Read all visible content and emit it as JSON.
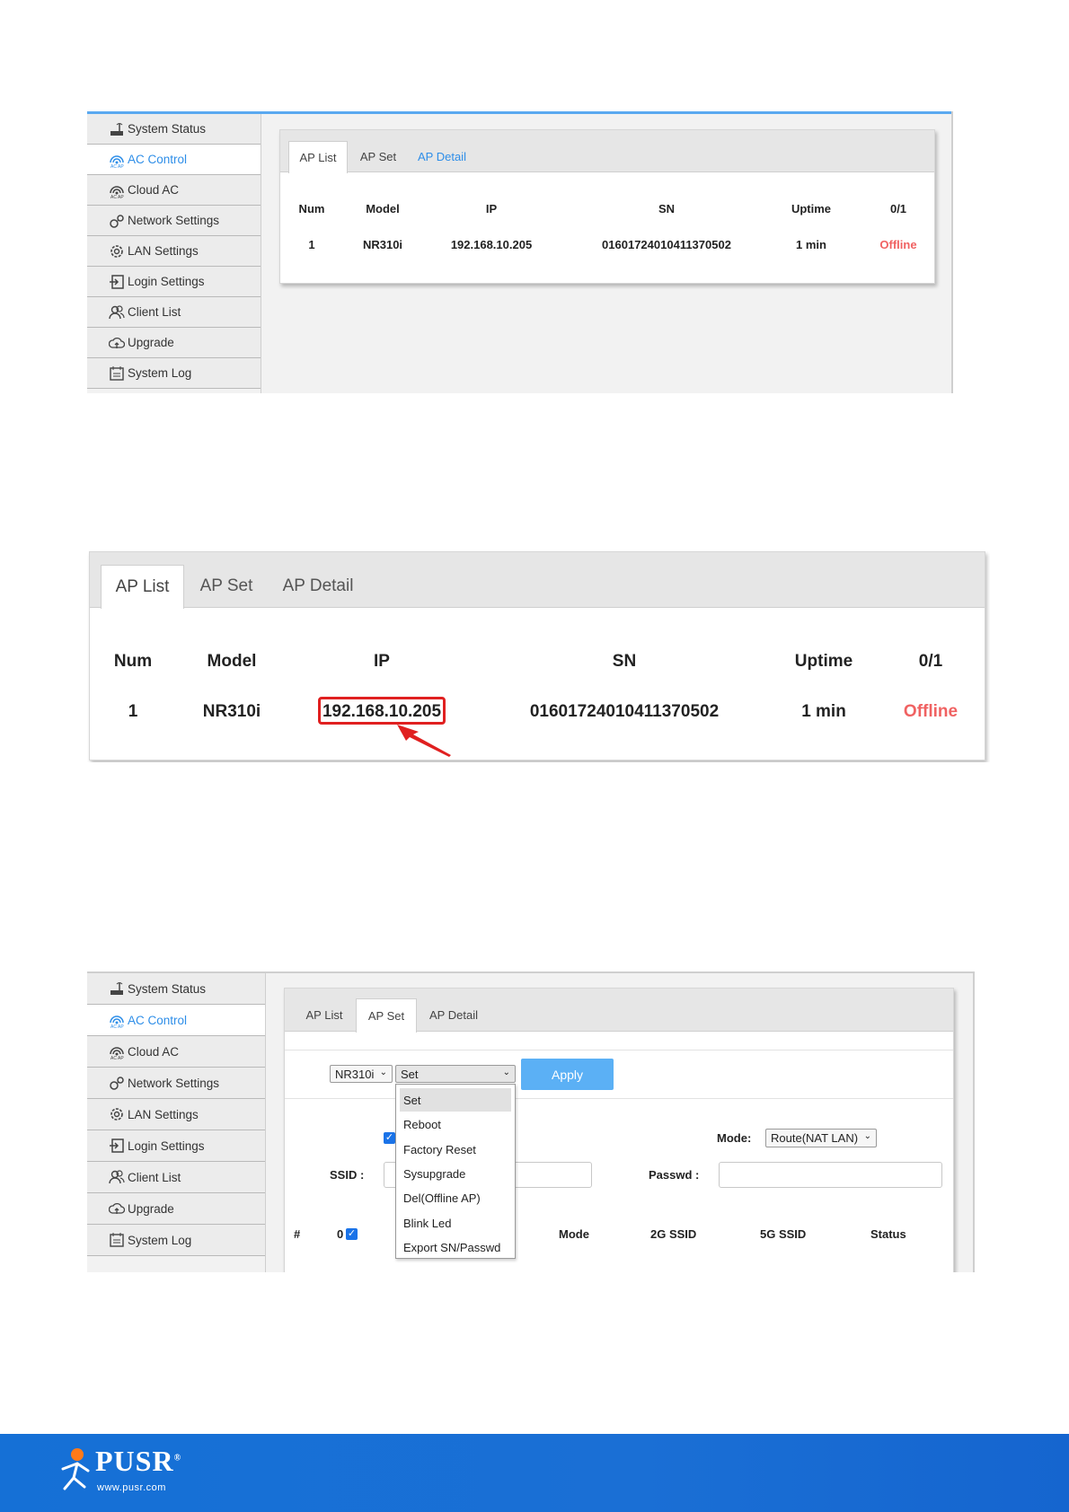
{
  "sidebar": {
    "items": [
      {
        "label": "System Status",
        "icon": "router-icon"
      },
      {
        "label": "AC Control",
        "icon": "ac-ap-icon"
      },
      {
        "label": "Cloud AC",
        "icon": "cloud-ac-icon"
      },
      {
        "label": "Network Settings",
        "icon": "network-gear-icon"
      },
      {
        "label": "LAN Settings",
        "icon": "gear-icon"
      },
      {
        "label": "Login Settings",
        "icon": "login-icon"
      },
      {
        "label": "Client List",
        "icon": "users-icon"
      },
      {
        "label": "Upgrade",
        "icon": "cloud-upload-icon"
      },
      {
        "label": "System Log",
        "icon": "log-icon"
      }
    ],
    "active": "AC Control"
  },
  "tabs": [
    "AP List",
    "AP Set",
    "AP Detail"
  ],
  "ap_list": {
    "headers": [
      "Num",
      "Model",
      "IP",
      "SN",
      "Uptime",
      "0/1"
    ],
    "rows": [
      {
        "num": "1",
        "model": "NR310i",
        "ip": "192.168.10.205",
        "sn": "01601724010411370502",
        "uptime": "1 min",
        "status": "Offline"
      }
    ]
  },
  "ap_set": {
    "model_select": "NR310i",
    "action_select": "Set",
    "apply_label": "Apply",
    "dropdown_options": [
      "Set",
      "Reboot",
      "Factory Reset",
      "Sysupgrade",
      "Del(Offline AP)",
      "Blink Led",
      "Export SN/Passwd"
    ],
    "mode_label": "Mode:",
    "mode_value": "Route(NAT LAN)",
    "ssid_label": "SSID :",
    "passwd_label": "Passwd :",
    "table_headers": [
      "#",
      "0",
      "Mode",
      "2G SSID",
      "5G SSID",
      "Status"
    ]
  },
  "footer": {
    "brand": "PUSR",
    "registered": "®",
    "url": "www.pusr.com"
  },
  "colors": {
    "accent": "#2e8ee8",
    "offline": "#f06262",
    "apply": "#5bb0f5",
    "footer": "#1570d6",
    "highlight": "#e02020"
  }
}
